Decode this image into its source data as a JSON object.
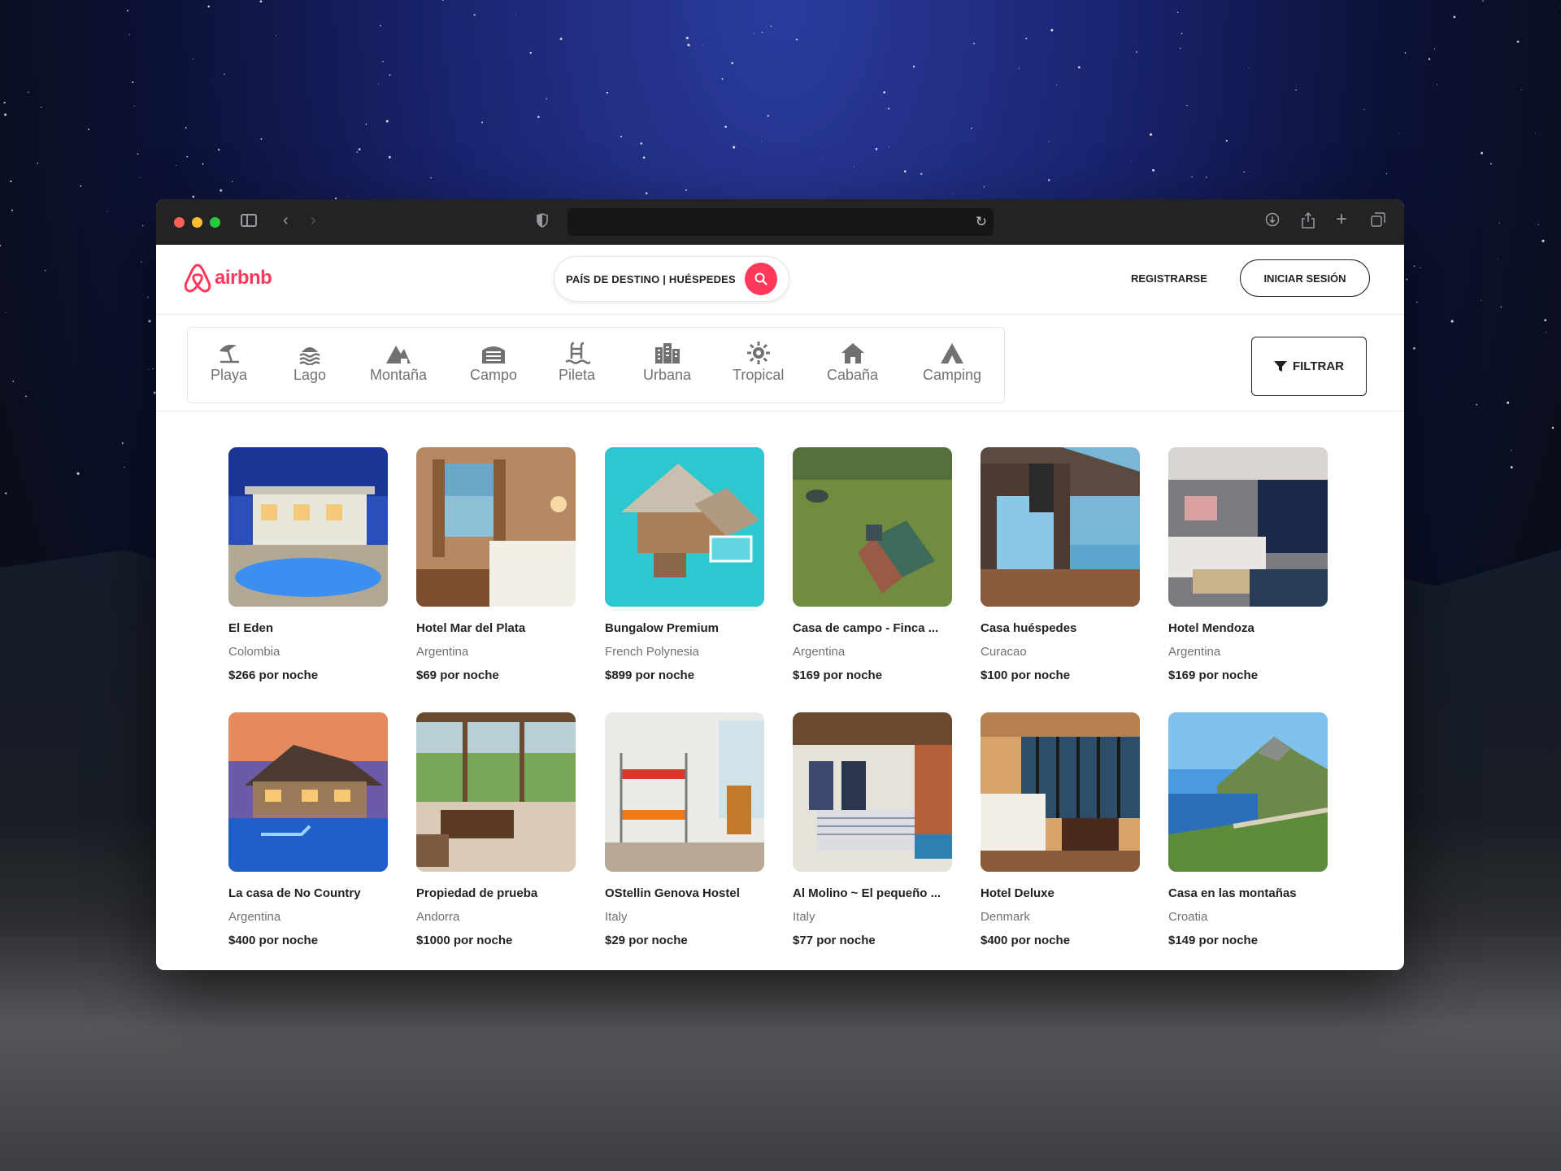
{
  "header": {
    "logo_text": "airbnb",
    "search_placeholder": "PAÍS DE DESTINO | HUÉSPEDES",
    "register_label": "REGISTRARSE",
    "login_label": "INICIAR SESIÓN"
  },
  "categories": [
    {
      "label": "Playa",
      "icon": "beach-umbrella-icon"
    },
    {
      "label": "Lago",
      "icon": "water-waves-icon"
    },
    {
      "label": "Montaña",
      "icon": "mountain-icon"
    },
    {
      "label": "Campo",
      "icon": "barn-icon"
    },
    {
      "label": "Pileta",
      "icon": "pool-icon"
    },
    {
      "label": "Urbana",
      "icon": "city-icon"
    },
    {
      "label": "Tropical",
      "icon": "sun-icon"
    },
    {
      "label": "Cabaña",
      "icon": "house-icon"
    },
    {
      "label": "Camping",
      "icon": "tent-icon"
    }
  ],
  "filter_label": "FILTRAR",
  "listings": [
    {
      "title": "El Eden",
      "country": "Colombia",
      "price": "$266 por noche"
    },
    {
      "title": "Hotel Mar del Plata",
      "country": "Argentina",
      "price": "$69 por noche"
    },
    {
      "title": "Bungalow Premium",
      "country": "French Polynesia",
      "price": "$899 por noche"
    },
    {
      "title": "Casa de campo - Finca ...",
      "country": "Argentina",
      "price": "$169 por noche"
    },
    {
      "title": "Casa huéspedes",
      "country": "Curacao",
      "price": "$100 por noche"
    },
    {
      "title": "Hotel Mendoza",
      "country": "Argentina",
      "price": "$169 por noche"
    },
    {
      "title": "La casa de No Country",
      "country": "Argentina",
      "price": "$400 por noche"
    },
    {
      "title": "Propiedad de prueba",
      "country": "Andorra",
      "price": "$1000 por noche"
    },
    {
      "title": "OStellin Genova Hostel",
      "country": "Italy",
      "price": "$29 por noche"
    },
    {
      "title": "Al Molino ~ El pequeño ...",
      "country": "Italy",
      "price": "$77 por noche"
    },
    {
      "title": "Hotel Deluxe",
      "country": "Denmark",
      "price": "$400 por noche"
    },
    {
      "title": "Casa en las montañas",
      "country": "Croatia",
      "price": "$149 por noche"
    }
  ],
  "colors": {
    "brand": "#ff385c"
  }
}
